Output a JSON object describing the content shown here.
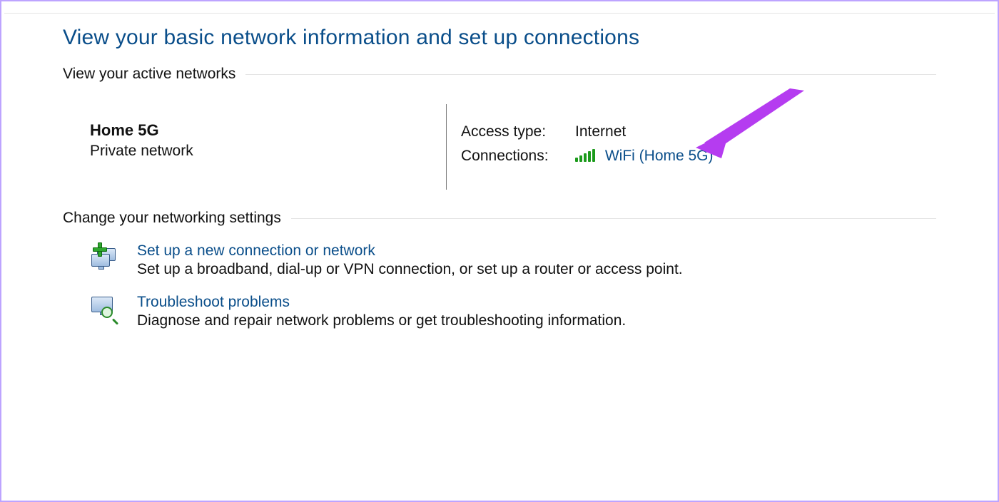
{
  "page_title": "View your basic network information and set up connections",
  "sections": {
    "active_networks": "View your active networks",
    "change_settings": "Change your networking settings"
  },
  "network": {
    "name": "Home 5G",
    "profile_type": "Private network",
    "access_type_label": "Access type:",
    "access_type_value": "Internet",
    "connections_label": "Connections:",
    "connection_link": "WiFi (Home 5G)",
    "signal_icon": "wifi-signal-full"
  },
  "options": [
    {
      "icon": "setup-connection-icon",
      "title": "Set up a new connection or network",
      "description": "Set up a broadband, dial-up or VPN connection, or set up a router or access point."
    },
    {
      "icon": "troubleshoot-icon",
      "title": "Troubleshoot problems",
      "description": "Diagnose and repair network problems or get troubleshooting information."
    }
  ],
  "annotation": {
    "arrow_color": "#b53cf0",
    "points_to": "connection-link"
  }
}
